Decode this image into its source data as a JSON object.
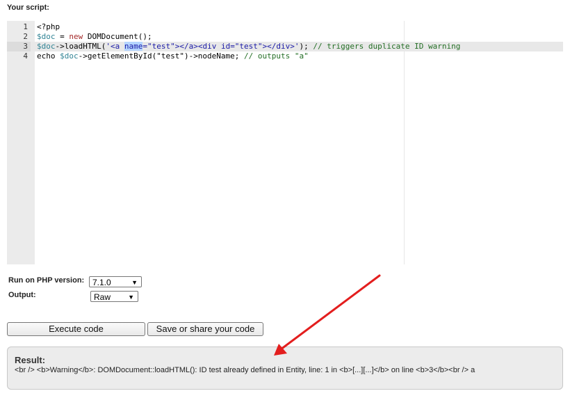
{
  "heading": "Your script:",
  "editor": {
    "lines": [
      {
        "number": "1",
        "tokens": [
          {
            "t": "<?php",
            "c": "tk-plain"
          }
        ]
      },
      {
        "number": "2",
        "tokens": [
          {
            "t": "$doc",
            "c": "tk-var"
          },
          {
            "t": " = ",
            "c": "tk-punct"
          },
          {
            "t": "new",
            "c": "tk-kw"
          },
          {
            "t": " DOMDocument();",
            "c": "tk-plain"
          }
        ]
      },
      {
        "number": "3",
        "active": true,
        "tokens": [
          {
            "t": "$doc",
            "c": "tk-var"
          },
          {
            "t": "->loadHTML(",
            "c": "tk-plain"
          },
          {
            "t": "'<a ",
            "c": "tk-str"
          },
          {
            "t": "name",
            "c": "tk-str tk-sel"
          },
          {
            "t": "=\"test\"></a><div id=\"test\"></div>'",
            "c": "tk-str"
          },
          {
            "t": "); ",
            "c": "tk-plain"
          },
          {
            "t": "// triggers duplicate ID warning",
            "c": "tk-com"
          }
        ]
      },
      {
        "number": "4",
        "tokens": [
          {
            "t": "echo ",
            "c": "tk-plain"
          },
          {
            "t": "$doc",
            "c": "tk-var"
          },
          {
            "t": "->getElementById(\"test\")->nodeName; ",
            "c": "tk-plain"
          },
          {
            "t": "// outputs \"a\"",
            "c": "tk-com"
          }
        ]
      }
    ]
  },
  "php_version": {
    "label": "Run on PHP version:",
    "value": "7.1.0"
  },
  "output": {
    "label": "Output:",
    "value": "Raw"
  },
  "buttons": {
    "execute": "Execute code",
    "save": "Save or share your code"
  },
  "result": {
    "title": "Result:",
    "text": "<br /> <b>Warning</b>: DOMDocument::loadHTML(): ID test already defined in Entity, line: 1 in <b>[...][...]</b> on line <b>3</b><br /> a"
  },
  "annotation_color": "#e31e1e",
  "icons": {
    "dropdown": "chevron-down-icon",
    "annotation": "arrow-annotation-icon"
  }
}
